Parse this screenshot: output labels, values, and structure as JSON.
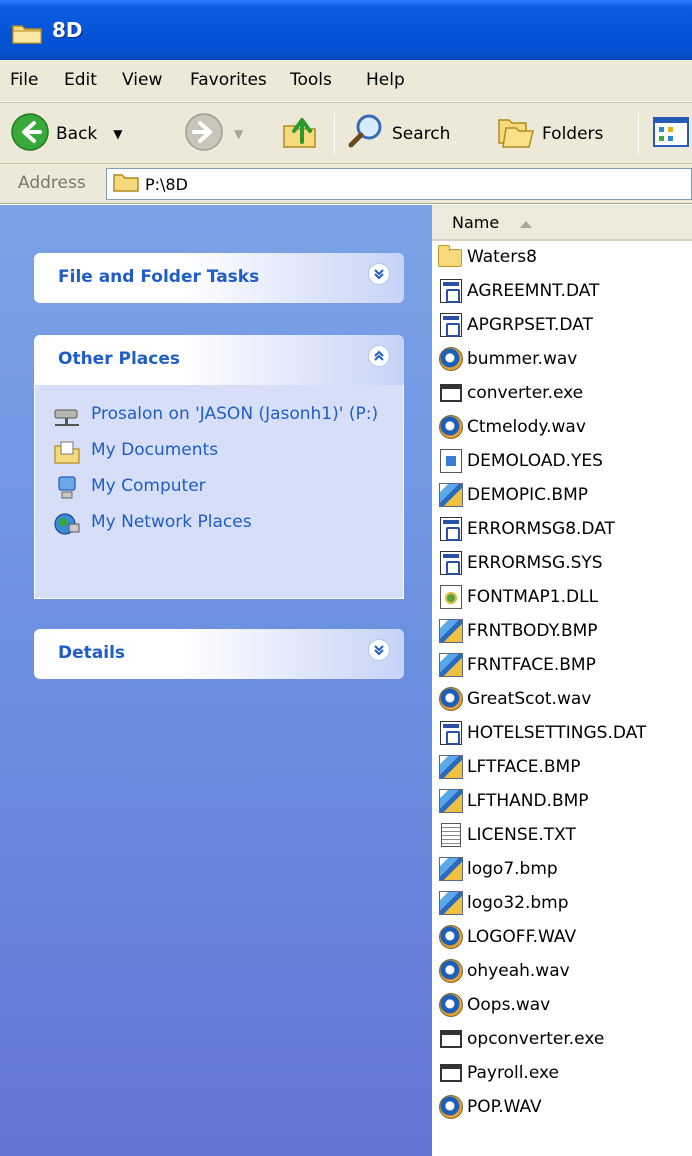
{
  "window": {
    "title": "8D"
  },
  "menu": [
    "File",
    "Edit",
    "View",
    "Favorites",
    "Tools",
    "Help"
  ],
  "toolbar": {
    "back_label": "Back",
    "search_label": "Search",
    "folders_label": "Folders"
  },
  "address": {
    "label": "Address",
    "value": "P:\\8D"
  },
  "taskpane": {
    "file_folder_tasks": {
      "title": "File and Folder Tasks"
    },
    "other_places": {
      "title": "Other Places",
      "items": [
        {
          "label": "Prosalon on 'JASON (Jasonh1)' (P:)",
          "icon": "network-drive-icon"
        },
        {
          "label": "My Documents",
          "icon": "my-documents-icon"
        },
        {
          "label": "My Computer",
          "icon": "my-computer-icon"
        },
        {
          "label": "My Network Places",
          "icon": "network-places-icon"
        }
      ]
    },
    "details": {
      "title": "Details"
    }
  },
  "filelist": {
    "column_name": "Name",
    "files": [
      {
        "name": "Waters8",
        "type": "folder"
      },
      {
        "name": "AGREEMNT.DAT",
        "type": "dat"
      },
      {
        "name": "APGRPSET.DAT",
        "type": "dat"
      },
      {
        "name": "bummer.wav",
        "type": "wav"
      },
      {
        "name": "converter.exe",
        "type": "exe"
      },
      {
        "name": "Ctmelody.wav",
        "type": "wav"
      },
      {
        "name": "DEMOLOAD.YES",
        "type": "yes"
      },
      {
        "name": "DEMOPIC.BMP",
        "type": "bmp"
      },
      {
        "name": "ERRORMSG8.DAT",
        "type": "dat"
      },
      {
        "name": "ERRORMSG.SYS",
        "type": "dat"
      },
      {
        "name": "FONTMAP1.DLL",
        "type": "dll"
      },
      {
        "name": "FRNTBODY.BMP",
        "type": "bmp"
      },
      {
        "name": "FRNTFACE.BMP",
        "type": "bmp"
      },
      {
        "name": "GreatScot.wav",
        "type": "wav"
      },
      {
        "name": "HOTELSETTINGS.DAT",
        "type": "dat"
      },
      {
        "name": "LFTFACE.BMP",
        "type": "bmp"
      },
      {
        "name": "LFTHAND.BMP",
        "type": "bmp"
      },
      {
        "name": "LICENSE.TXT",
        "type": "txt"
      },
      {
        "name": "logo7.bmp",
        "type": "bmp"
      },
      {
        "name": "logo32.bmp",
        "type": "bmp"
      },
      {
        "name": "LOGOFF.WAV",
        "type": "wav"
      },
      {
        "name": "ohyeah.wav",
        "type": "wav"
      },
      {
        "name": "Oops.wav",
        "type": "wav"
      },
      {
        "name": "opconverter.exe",
        "type": "exe"
      },
      {
        "name": "Payroll.exe",
        "type": "exe"
      },
      {
        "name": "POP.WAV",
        "type": "wav"
      }
    ]
  }
}
